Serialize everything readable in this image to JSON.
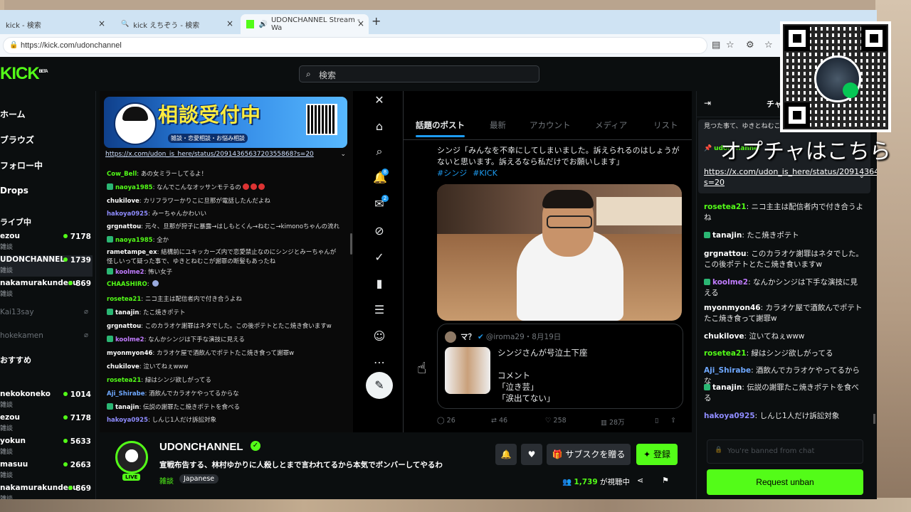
{
  "browser": {
    "tabs": [
      {
        "label": "kick - 検索"
      },
      {
        "label": "kick えちぞう - 検索"
      },
      {
        "label": "UDONCHANNEL Stream - Wa"
      }
    ],
    "url": "https://kick.com/udonchannel"
  },
  "kick": {
    "logo": "KICK",
    "logo_badge": "BETA",
    "search_placeholder": "検索",
    "accent": "#53fc18"
  },
  "sidebar": {
    "nav": [
      "ホーム",
      "ブラウズ",
      "フォロー中",
      "Drops"
    ],
    "section1": "ライブ中",
    "section2": "おすすめ",
    "channels": [
      {
        "name": "ezou",
        "sub": "雑談",
        "viewers": "7178"
      },
      {
        "name": "UDONCHANNEL",
        "sub": "雑談",
        "viewers": "1739"
      },
      {
        "name": "nakamurakundesu",
        "sub": "雑談",
        "viewers": "869"
      },
      {
        "name": "Kai13say",
        "sub": "",
        "viewers": ""
      },
      {
        "name": "hokekamen",
        "sub": "",
        "viewers": ""
      },
      {
        "name": "nekokoneko",
        "sub": "雑談",
        "viewers": "1014"
      },
      {
        "name": "ezou",
        "sub": "雑談",
        "viewers": "7178"
      },
      {
        "name": "yokun",
        "sub": "雑談",
        "viewers": "5633"
      },
      {
        "name": "masuu",
        "sub": "雑談",
        "viewers": "2663"
      },
      {
        "name": "nakamurakundesu",
        "sub": "雑談",
        "viewers": "869"
      }
    ]
  },
  "video": {
    "banner_title_a": "相談",
    "banner_title_b": "受付中",
    "banner_tagline": "雑談・恋愛相談・お悩み相談",
    "pinned_link": "https://x.com/udon_is_here/status/2091436563720355868?s=20",
    "chat": [
      {
        "user": "Cow_Bell",
        "color": "#53fc18",
        "sub": false,
        "text": "あの女ミラーしてるよ！"
      },
      {
        "user": "naoya1985",
        "color": "#53fc18",
        "sub": true,
        "text": "なんでこんなオッサンモテるの"
      },
      {
        "user": "chukilove",
        "color": "#ffffff",
        "sub": false,
        "text": "カリフラワーかりこに旦那が電話したんだよね"
      },
      {
        "user": "hakoya0925",
        "color": "#8f8cff",
        "sub": false,
        "text": "みーちゃんかわいい"
      },
      {
        "user": "grgnattou",
        "color": "#ffffff",
        "sub": false,
        "text": "元々、旦那が狩子に暴露→はしもとくん→ねむこ→kimonoちゃんの流れ"
      },
      {
        "user": "naoya1985",
        "color": "#53fc18",
        "sub": true,
        "text": "全か"
      },
      {
        "user": "rametampe_ex",
        "color": "#ffffff",
        "sub": false,
        "text": "結構前にユキッカーズ内で恋愛禁止なのにシンジとみーちゃんが怪しいって疑った事で、ゆきとねむこが謝罪の断髪もあったね"
      },
      {
        "user": "koolme2",
        "color": "#c17cff",
        "sub": true,
        "text": "怖い女子"
      },
      {
        "user": "CHAASHIRO",
        "color": "#53fc18",
        "sub": false,
        "text": ""
      },
      {
        "user": "rosetea21",
        "color": "#53fc18",
        "sub": false,
        "text": "ニコ主主は配信者内で付き合うよね"
      },
      {
        "user": "tanajin",
        "color": "#ffffff",
        "sub": true,
        "text": "たこ焼きポテト"
      },
      {
        "user": "grgnattou",
        "color": "#ffffff",
        "sub": false,
        "text": "このカラオケ謝罪はネタでした。この後ポテトとたこ焼き食いますw"
      },
      {
        "user": "koolme2",
        "color": "#c17cff",
        "sub": true,
        "text": "なんかシンジは下手な演技に見える"
      },
      {
        "user": "myonmyon46",
        "color": "#ffffff",
        "sub": false,
        "text": "カラオケ屋で酒飲んでポテトたこ焼き食って謝罪w"
      },
      {
        "user": "chukilove",
        "color": "#ffffff",
        "sub": false,
        "text": "泣いてねぇwww"
      },
      {
        "user": "rosetea21",
        "color": "#53fc18",
        "sub": false,
        "text": "緑はシンジ欲しがってる"
      },
      {
        "user": "Aji_Shirabe",
        "color": "#6fa8ff",
        "sub": false,
        "text": "酒飲んでカラオケやってるからな"
      },
      {
        "user": "tanajin",
        "color": "#ffffff",
        "sub": true,
        "text": "伝説の謝罪たこ焼きポテトを食べる"
      },
      {
        "user": "hakoya0925",
        "color": "#8f8cff",
        "sub": false,
        "text": "しんじ1人だけ訴訟対象"
      }
    ]
  },
  "x_app": {
    "tabs": [
      "話題のポスト",
      "最新",
      "アカウント",
      "メディア",
      "リスト"
    ],
    "tweet_text": "シンジ「みんなを不幸にしてしまいました。訴えられるのはしょうがないと思います。訴えるなら私だけでお願いします」",
    "hashtags": [
      "#シンジ",
      "#KICK"
    ],
    "quote": {
      "name": "マ？",
      "handle": "@iroma29・8月19日",
      "body": "シンジさんが号泣土下座\n\nコメント\n「泣き芸」\n「涙出てない」"
    },
    "actions": {
      "replies": "26",
      "reposts": "46",
      "likes": "258",
      "views": "28万"
    },
    "notif_count": "8",
    "msg_count": "2"
  },
  "chat_panel": {
    "header": "チャット",
    "pinned_top": "見つた事て、ゆきとねむこが謝罪の断髪もあった",
    "pinned_user": "udonchannel",
    "pinned_link": "https://x.com/udon_is_here/status/2091436456372035586?s=20",
    "messages": [
      {
        "user": "rosetea21",
        "color": "#53fc18",
        "sub": false,
        "text": "ニコ主主は配信者内で付き合うよね"
      },
      {
        "user": "tanajin",
        "color": "#ffffff",
        "sub": true,
        "text": "たこ焼きポテト"
      },
      {
        "user": "grgnattou",
        "color": "#ffffff",
        "sub": false,
        "text": "このカラオケ謝罪はネタでした。この後ポテトとたこ焼き食いますw"
      },
      {
        "user": "koolme2",
        "color": "#c17cff",
        "sub": true,
        "text": "なんかシンジは下手な演技に見える"
      },
      {
        "user": "myonmyon46",
        "color": "#ffffff",
        "sub": false,
        "text": "カラオケ屋で酒飲んでポテトたこ焼き食って謝罪w"
      },
      {
        "user": "chukilove",
        "color": "#ffffff",
        "sub": false,
        "text": "泣いてねぇwww"
      },
      {
        "user": "rosetea21",
        "color": "#53fc18",
        "sub": false,
        "text": "緑はシンジ欲しがってる"
      },
      {
        "user": "Aji_Shirabe",
        "color": "#6fa8ff",
        "sub": false,
        "text": "酒飲んでカラオケやってるからな"
      },
      {
        "user": "tanajin",
        "color": "#ffffff",
        "sub": true,
        "text": "伝説の謝罪たこ焼きポテトを食べる"
      },
      {
        "user": "hakoya0925",
        "color": "#8f8cff",
        "sub": false,
        "text": "しんじ1人だけ訴訟対象"
      }
    ],
    "input_placeholder": "You're banned from chat",
    "unban_label": "Request unban"
  },
  "channel_info": {
    "name": "UDONCHANNEL",
    "live_badge": "LIVE",
    "stream_title": "宣戦布告する、林村ゆかりに人殺しとまで言われてるから本気でボンバーしてやるわ",
    "category": "雑談",
    "language": "Japanese",
    "gift_label": "サブスクを贈る",
    "subscribe_label": "登録",
    "viewer_count": "1,739",
    "viewer_suffix": "が視聴中"
  },
  "overlay": {
    "text": "オプチャはこちら"
  }
}
